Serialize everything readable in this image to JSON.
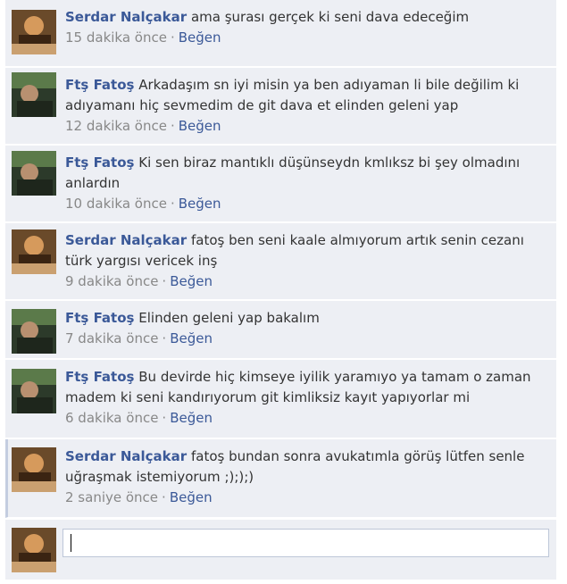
{
  "comments": [
    {
      "author": "Serdar Nalçakar",
      "avatar": "serdar",
      "text": "ama şurası gerçek ki seni dava edeceğim",
      "time": "15 dakika önce",
      "like": "Beğen"
    },
    {
      "author": "Ftş Fatoş",
      "avatar": "fatos",
      "text": "Arkadaşım sn iyi misin ya ben adıyaman li bile değilim ki adıyamanı hiç sevmedim de git dava et elinden geleni yap",
      "time": "12 dakika önce",
      "like": "Beğen"
    },
    {
      "author": "Ftş Fatoş",
      "avatar": "fatos",
      "text": "Ki sen biraz mantıklı düşünseydn kmlıksz bi şey olmadını anlardın",
      "time": "10 dakika önce",
      "like": "Beğen"
    },
    {
      "author": "Serdar Nalçakar",
      "avatar": "serdar",
      "text": "fatoş ben seni kaale almıyorum artık senin cezanı türk yargısı vericek inş",
      "time": "9 dakika önce",
      "like": "Beğen"
    },
    {
      "author": "Ftş Fatoş",
      "avatar": "fatos",
      "text": "Elinden geleni yap bakalım",
      "time": "7 dakika önce",
      "like": "Beğen"
    },
    {
      "author": "Ftş Fatoş",
      "avatar": "fatos",
      "text": "Bu devirde hiç kimseye iyilik yaramıyo ya tamam o zaman madem ki seni kandırıyorum git kimliksiz kayıt yapıyorlar mi",
      "time": "6 dakika önce",
      "like": "Beğen"
    },
    {
      "author": "Serdar Nalçakar",
      "avatar": "serdar",
      "text": "fatoş bundan sonra avukatımla görüş lütfen senle uğraşmak istemiyorum ;););)",
      "time": "2 saniye önce",
      "like": "Beğen"
    }
  ],
  "compose": {
    "avatar": "serdar",
    "value": ""
  },
  "separator": "·",
  "colors": {
    "background": "#edeff4",
    "link": "#3b5998",
    "meta": "#888888"
  }
}
